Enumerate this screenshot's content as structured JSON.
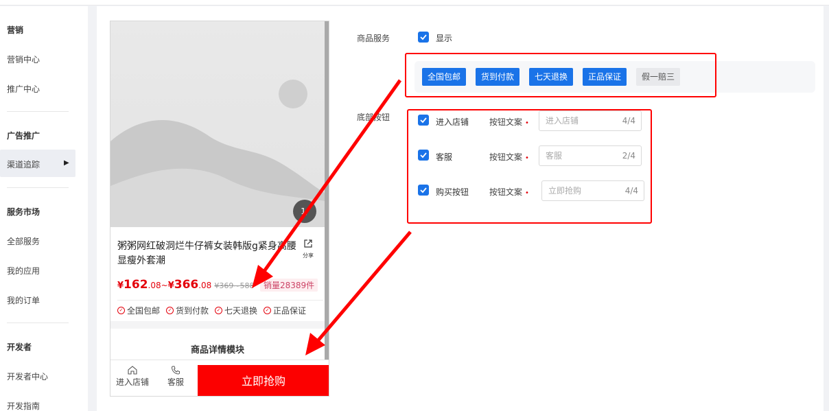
{
  "sidebar": {
    "groups": [
      {
        "title": "营销",
        "items": [
          "营销中心",
          "推广中心"
        ]
      },
      {
        "title": "广告推广",
        "items": [
          "渠道追踪"
        ]
      },
      {
        "title": "服务市场",
        "items": [
          "全部服务",
          "我的应用",
          "我的订单"
        ]
      },
      {
        "title": "开发者",
        "items": [
          "开发者中心",
          "开发指南"
        ]
      }
    ]
  },
  "preview": {
    "image_badge": "1/",
    "title": "粥粥网红破洞烂牛仔裤女装韩版g紧身高腰显瘦外套潮",
    "share_label": "分享",
    "price": {
      "currency": "¥",
      "low_int": "162",
      "low_dec": ".08~",
      "currency2": "¥",
      "high_int": "366",
      "high_dec": ".08",
      "original": "¥369~588"
    },
    "sales": "销量28389件",
    "services": [
      "全国包邮",
      "货到付款",
      "七天退换",
      "正品保证"
    ],
    "detail_title": "商品详情模块",
    "bottom": {
      "store": "进入店铺",
      "service": "客服",
      "buy": "立即抢购"
    }
  },
  "config": {
    "service_label": "商品服务",
    "show_label": "显示",
    "tags": [
      {
        "text": "全国包邮",
        "selected": true
      },
      {
        "text": "货到付款",
        "selected": true
      },
      {
        "text": "七天退换",
        "selected": true
      },
      {
        "text": "正品保证",
        "selected": true
      },
      {
        "text": "假一赔三",
        "selected": false
      }
    ],
    "bottom_label": "底部按钮",
    "buttons": [
      {
        "checkbox_label": "进入店铺",
        "field_label": "按钮文案",
        "required": "•",
        "placeholder": "进入店铺",
        "count": "4/4"
      },
      {
        "checkbox_label": "客服",
        "field_label": "按钮文案",
        "required": "•",
        "placeholder": "客服",
        "count": "2/4"
      },
      {
        "checkbox_label": "购买按钮",
        "field_label": "按钮文案",
        "required": "•",
        "placeholder": "立即抢购",
        "count": "4/4"
      }
    ]
  },
  "colors": {
    "accent": "#1a73e8",
    "buy": "#fc0000",
    "annotation": "#ff0000"
  }
}
